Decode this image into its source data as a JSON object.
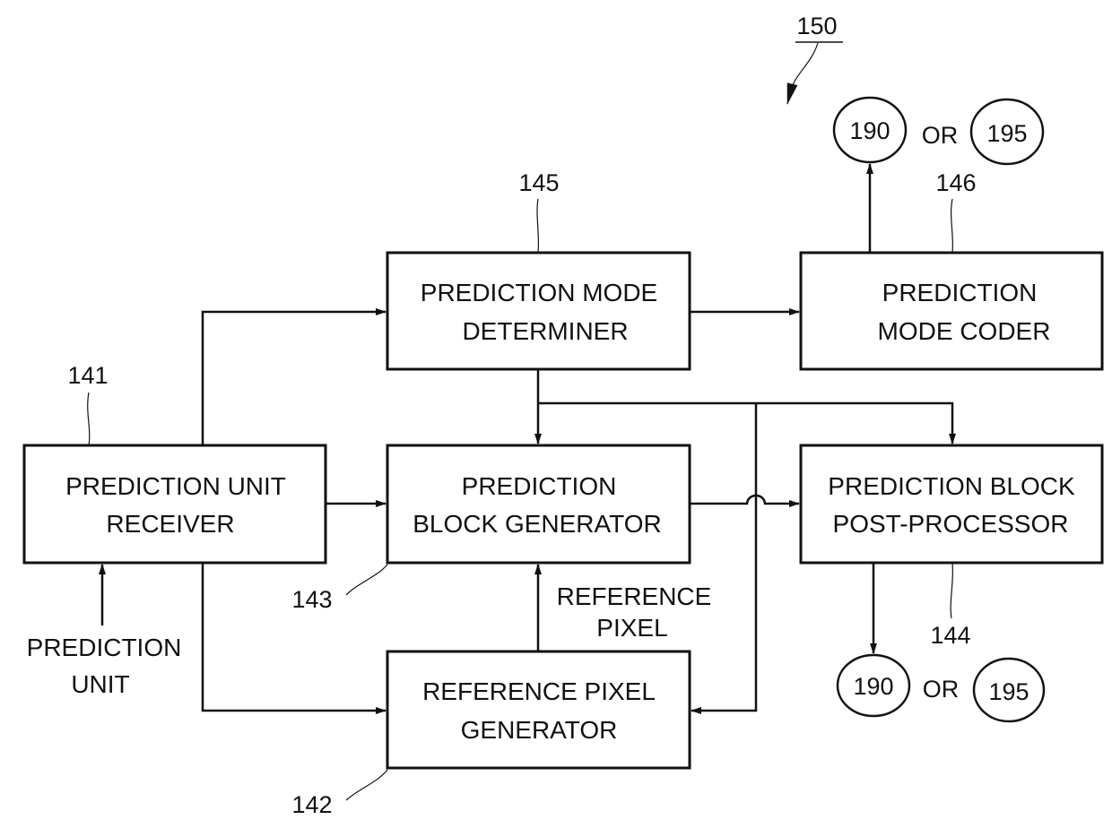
{
  "figure_ref": "150",
  "blocks": {
    "prediction_mode_determiner": {
      "ref": "145",
      "line1": "PREDICTION MODE",
      "line2": "DETERMINER"
    },
    "prediction_mode_coder": {
      "ref": "146",
      "line1": "PREDICTION",
      "line2": "MODE CODER"
    },
    "prediction_unit_receiver": {
      "ref": "141",
      "line1": "PREDICTION UNIT",
      "line2": "RECEIVER"
    },
    "prediction_block_generator": {
      "ref": "143",
      "line1": "PREDICTION",
      "line2": "BLOCK GENERATOR"
    },
    "prediction_block_post_processor": {
      "ref": "144",
      "line1": "PREDICTION BLOCK",
      "line2": "POST-PROCESSOR"
    },
    "reference_pixel_generator": {
      "ref": "142",
      "line1": "REFERENCE PIXEL",
      "line2": "GENERATOR"
    }
  },
  "labels": {
    "input_line1": "PREDICTION",
    "input_line2": "UNIT",
    "reference_pixel_line1": "REFERENCE",
    "reference_pixel_line2": "PIXEL"
  },
  "outputs": {
    "top": {
      "a": "190",
      "or": "OR",
      "b": "195"
    },
    "bottom": {
      "a": "190",
      "or": "OR",
      "b": "195"
    }
  }
}
